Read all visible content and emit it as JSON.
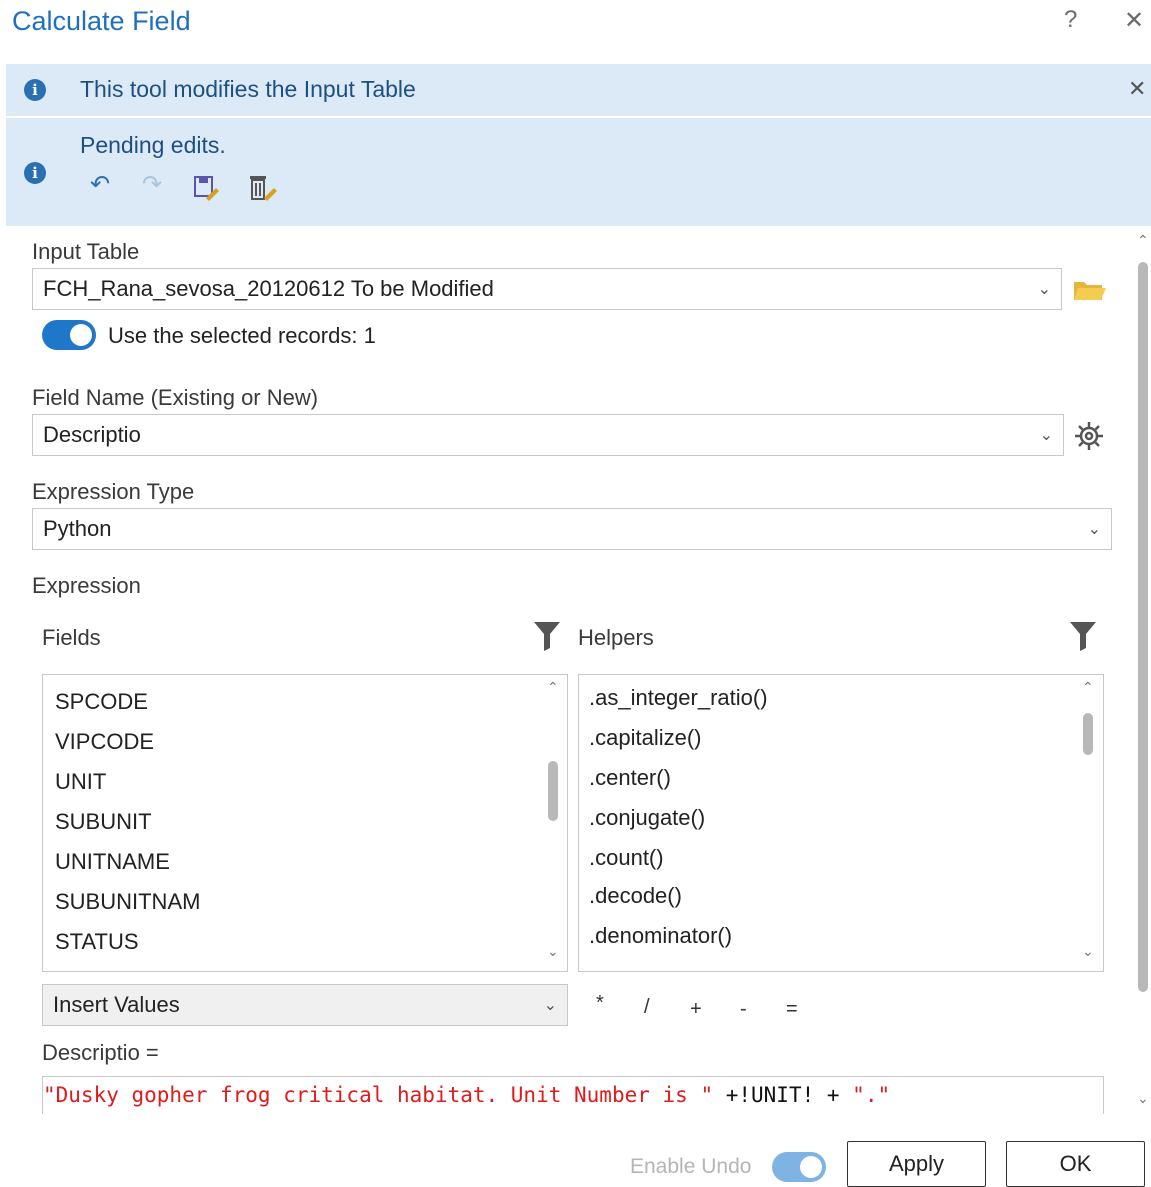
{
  "window": {
    "title": "Calculate Field",
    "help_label": "?",
    "close_label": "✕"
  },
  "banner_modify": {
    "icon": "info-icon",
    "text": "This tool modifies the Input Table",
    "close_label": "✕"
  },
  "banner_pending": {
    "icon": "info-icon",
    "text": "Pending edits.",
    "actions": [
      "undo-icon",
      "redo-icon",
      "save-edits-icon",
      "discard-edits-icon"
    ]
  },
  "input_table": {
    "label": "Input Table",
    "value": "FCH_Rana_sevosa_20120612 To be Modified",
    "browse_icon": "folder-open-icon",
    "use_selected_label": "Use the selected records: 1",
    "use_selected_on": true
  },
  "field_name": {
    "label": "Field Name (Existing or New)",
    "value": "Descriptio",
    "settings_icon": "gear-icon"
  },
  "expression_type": {
    "label": "Expression Type",
    "value": "Python"
  },
  "expression": {
    "label": "Expression",
    "fields_header": "Fields",
    "helpers_header": "Helpers",
    "fields": [
      "SPCODE",
      "VIPCODE",
      "UNIT",
      "SUBUNIT",
      "UNITNAME",
      "SUBUNITNAM",
      "STATUS"
    ],
    "helpers": [
      ".as_integer_ratio()",
      ".capitalize()",
      ".center()",
      ".conjugate()",
      ".count()",
      ".decode()",
      ".denominator()"
    ],
    "insert_values_label": "Insert Values",
    "operators": [
      "*",
      "/",
      "+",
      "-",
      "="
    ],
    "target_label": "Descriptio =",
    "code_string_part": "\"Dusky gopher frog critical habitat. Unit Number is \"",
    "code_middle_part": " +!UNIT! + ",
    "code_end_part": "\".\""
  },
  "footer": {
    "enable_undo_label": "Enable Undo",
    "apply_label": "Apply",
    "ok_label": "OK"
  },
  "colors": {
    "title": "#1f6fc0",
    "banner_bg": "#dbeaf6",
    "toggle_on": "#1f77c9",
    "code_string": "#e01b1b",
    "code_plain": "#111111"
  }
}
